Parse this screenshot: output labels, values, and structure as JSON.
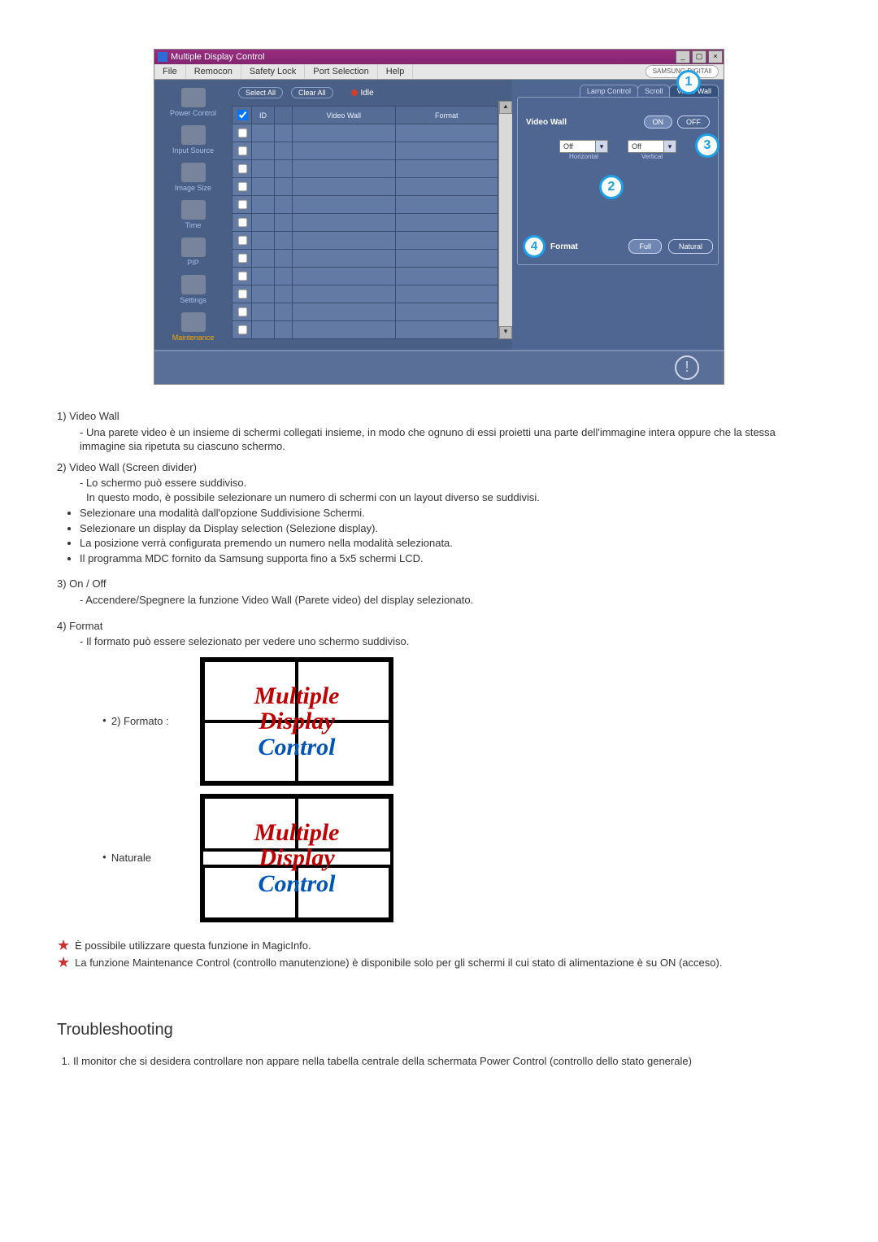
{
  "app": {
    "title": "Multiple Display Control",
    "menus": [
      "File",
      "Remocon",
      "Safety Lock",
      "Port Selection",
      "Help"
    ],
    "brand": "SAMSUNG DIGITAll",
    "sidebar": [
      {
        "label": "Power Control"
      },
      {
        "label": "Input Source"
      },
      {
        "label": "Image Size"
      },
      {
        "label": "Time"
      },
      {
        "label": "PIP"
      },
      {
        "label": "Settings"
      },
      {
        "label": "Maintenance",
        "active": true
      }
    ],
    "topButtons": {
      "selectAll": "Select All",
      "clearAll": "Clear All",
      "idle": "Idle"
    },
    "table": {
      "headers": [
        "",
        "ID",
        "",
        "Video Wall",
        "Format"
      ],
      "rowCount": 12
    },
    "rpanel": {
      "tabs": [
        {
          "label": "Lamp Control"
        },
        {
          "label": "Scroll"
        },
        {
          "label": "Video Wall",
          "active": true
        }
      ],
      "videoWallLabel": "Video Wall",
      "on": "ON",
      "off": "OFF",
      "horizontal": {
        "value": "Off",
        "label": "Horizontal"
      },
      "vertical": {
        "value": "Off",
        "label": "Vertical"
      },
      "formatLabel": "Format",
      "full": "Full",
      "natural": "Natural"
    },
    "callouts": {
      "c1": "1",
      "c2": "2",
      "c3": "3",
      "c4": "4"
    }
  },
  "doc": {
    "i1t": "1)  Video Wall",
    "i1a": "- Una parete video è un insieme di schermi collegati insieme, in modo che ognuno di essi proietti una parte dell'immagine intera oppure che la stessa immagine sia ripetuta su ciascuno schermo.",
    "i2t": "2)  Video Wall (Screen divider)",
    "i2a": "- Lo schermo può essere suddiviso.",
    "i2b": "In questo modo, è possibile selezionare un numero di schermi con un layout diverso se suddivisi.",
    "i2b1": "Selezionare una modalità dall'opzione Suddivisione Schermi.",
    "i2b2": "Selezionare un display da Display selection (Selezione display).",
    "i2b3": "La posizione verrà configurata premendo un numero nella modalità selezionata.",
    "i2b4": "Il programma MDC fornito da Samsung supporta fino a 5x5 schermi LCD.",
    "i3t": "3)  On / Off",
    "i3a": "- Accendere/Spegnere la funzione Video Wall (Parete video) del display selezionato.",
    "i4t": "4)  Format",
    "i4a": "- Il formato può essere selezionato per vedere uno schermo suddiviso.",
    "tile1": "2) Formato :",
    "tile2": "Naturale",
    "mdc1": "Multiple",
    "mdc2": "Display",
    "mdc3": "Control",
    "note1": "È possibile utilizzare questa funzione in MagicInfo.",
    "note2": "La funzione Maintenance Control (controllo manutenzione) è disponibile solo per gli schermi il cui stato di alimentazione è su ON (acceso)."
  },
  "ts": {
    "heading": "Troubleshooting",
    "item1": "Il monitor che si desidera controllare non appare nella tabella centrale della schermata Power Control (controllo dello stato generale)"
  }
}
